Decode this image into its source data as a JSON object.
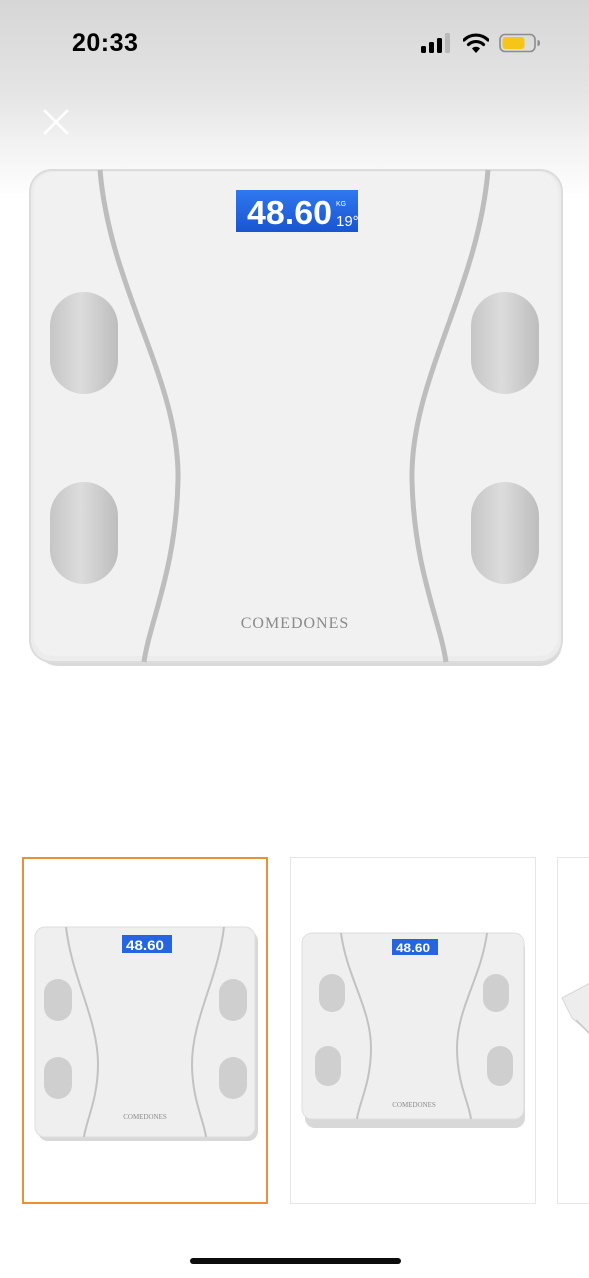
{
  "status_bar": {
    "time": "20:33",
    "signal_icon": "cellular-signal-icon",
    "wifi_icon": "wifi-icon",
    "battery_icon": "battery-icon",
    "battery_color": "#f5c518"
  },
  "header": {
    "close_icon": "close-icon"
  },
  "product": {
    "display_reading": "48.60",
    "display_unit": "KG",
    "display_temp": "19°",
    "brand": "COMEDONES",
    "lcd_color": "#1f63e0"
  },
  "gallery": {
    "selected_index": 0,
    "selected_border_color": "#e8913a",
    "thumbnails": [
      {
        "reading": "48.60",
        "brand": "COMEDONES"
      },
      {
        "reading": "48.60",
        "brand": "COMEDONES"
      },
      {
        "reading": "",
        "brand": ""
      }
    ]
  }
}
